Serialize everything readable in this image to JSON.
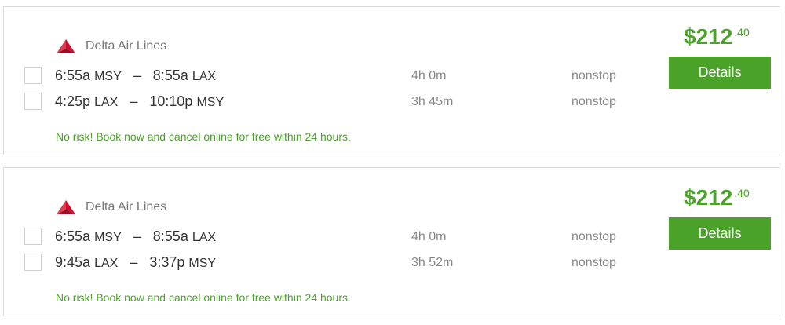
{
  "colors": {
    "accent": "#4aa328",
    "airline_logo": "#c8102e"
  },
  "results": [
    {
      "airline": {
        "name": "Delta Air Lines",
        "logo_icon": "delta-widget-icon"
      },
      "price": {
        "dollars": "$212",
        "cents": ".40"
      },
      "details_label": "Details",
      "flights": [
        {
          "depart_time": "6:55a",
          "depart_code": "MSY",
          "arrive_time": "8:55a",
          "arrive_code": "LAX",
          "duration": "4h 0m",
          "stops": "nonstop"
        },
        {
          "depart_time": "4:25p",
          "depart_code": "LAX",
          "arrive_time": "10:10p",
          "arrive_code": "MSY",
          "duration": "3h 45m",
          "stops": "nonstop"
        }
      ],
      "note": "No risk! Book now and cancel online for free within 24 hours."
    },
    {
      "airline": {
        "name": "Delta Air Lines",
        "logo_icon": "delta-widget-icon"
      },
      "price": {
        "dollars": "$212",
        "cents": ".40"
      },
      "details_label": "Details",
      "flights": [
        {
          "depart_time": "6:55a",
          "depart_code": "MSY",
          "arrive_time": "8:55a",
          "arrive_code": "LAX",
          "duration": "4h 0m",
          "stops": "nonstop"
        },
        {
          "depart_time": "9:45a",
          "depart_code": "LAX",
          "arrive_time": "3:37p",
          "arrive_code": "MSY",
          "duration": "3h 52m",
          "stops": "nonstop"
        }
      ],
      "note": "No risk! Book now and cancel online for free within 24 hours."
    }
  ]
}
